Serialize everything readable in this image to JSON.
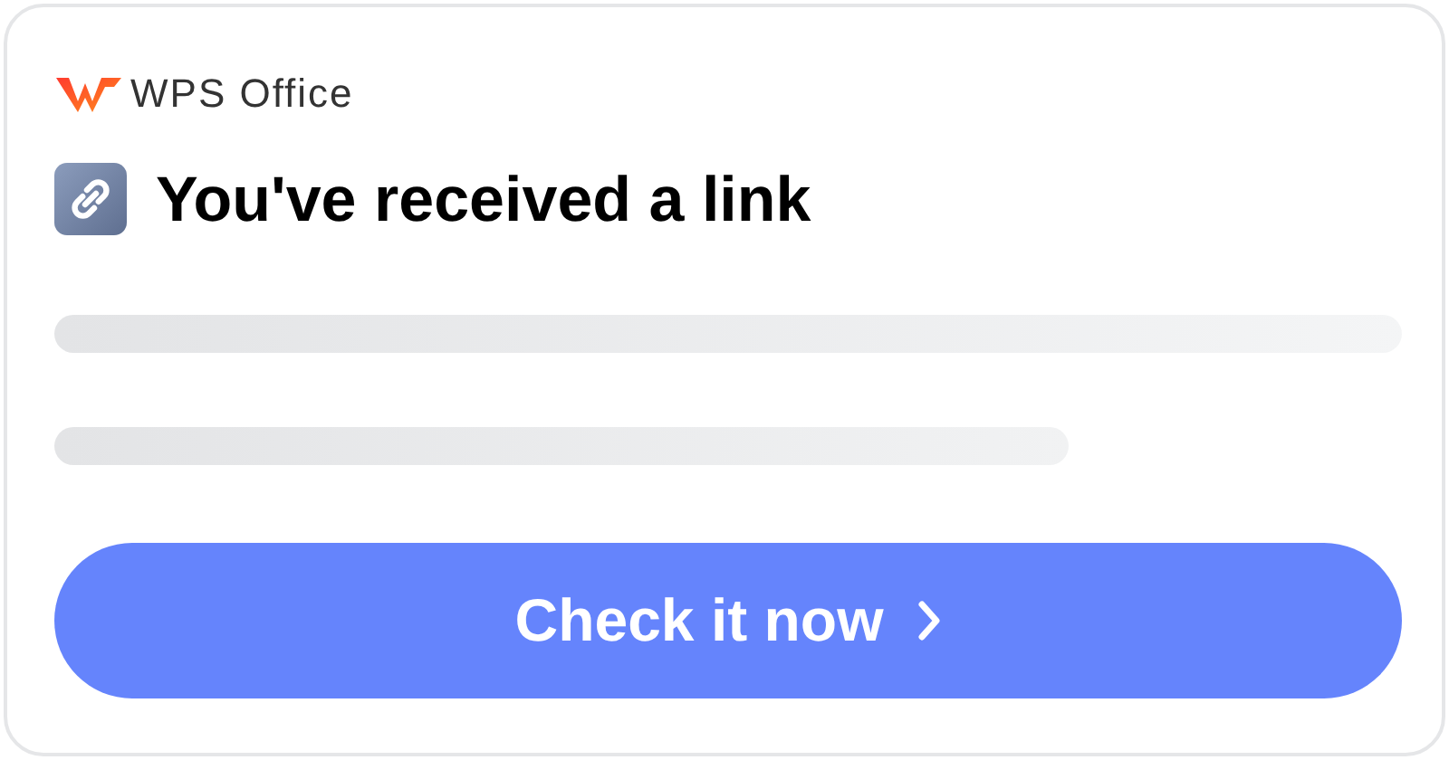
{
  "brand": {
    "name": "WPS Office"
  },
  "title": "You've received a link",
  "button": {
    "label": "Check it now"
  }
}
